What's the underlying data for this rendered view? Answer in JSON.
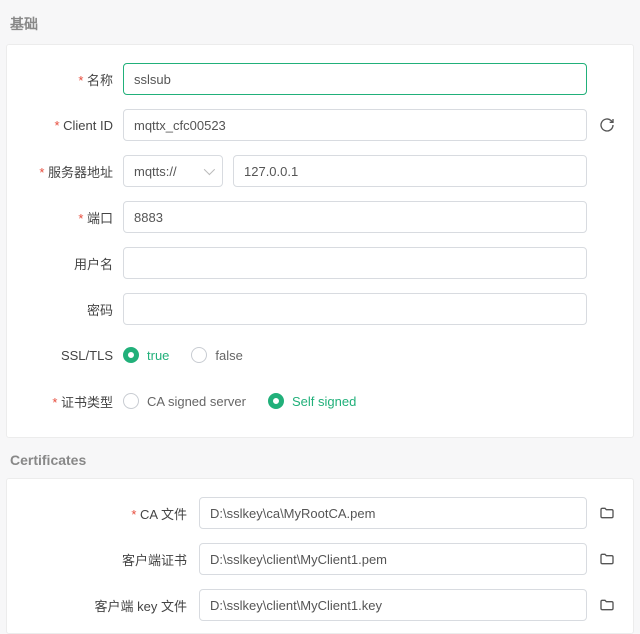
{
  "sections": {
    "basic": "基础",
    "certs": "Certificates"
  },
  "labels": {
    "name": "名称",
    "clientId": "Client ID",
    "host": "服务器地址",
    "port": "端口",
    "username": "用户名",
    "password": "密码",
    "ssl": "SSL/TLS",
    "certType": "证书类型",
    "caFile": "CA 文件",
    "clientCert": "客户端证书",
    "clientKey": "客户端 key 文件"
  },
  "values": {
    "name": "sslsub",
    "clientId": "mqttx_cfc00523",
    "protocol": "mqtts://",
    "host": "127.0.0.1",
    "port": "8883",
    "username": "",
    "password": "",
    "caFile": "D:\\sslkey\\ca\\MyRootCA.pem",
    "clientCert": "D:\\sslkey\\client\\MyClient1.pem",
    "clientKey": "D:\\sslkey\\client\\MyClient1.key"
  },
  "radio": {
    "true": "true",
    "false": "false",
    "caSigned": "CA signed server",
    "selfSigned": "Self signed"
  }
}
